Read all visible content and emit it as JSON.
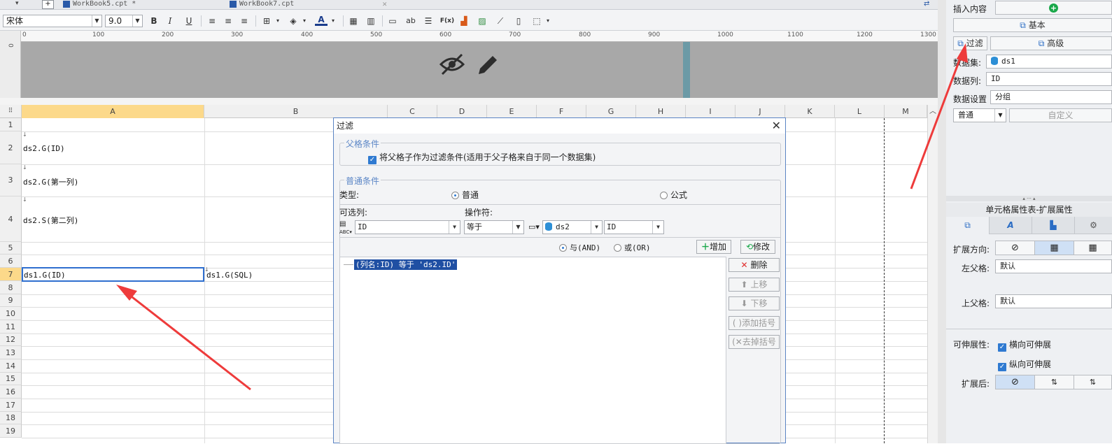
{
  "tabs": [
    {
      "label": "WorkBook5.cpt *"
    },
    {
      "label": "WorkBook7.cpt"
    }
  ],
  "toolbar": {
    "font_name": "宋体",
    "font_size": "9.0",
    "bold": "B",
    "italic": "I",
    "underline": "U",
    "abc_label": "ab",
    "fx_label": "F(x)"
  },
  "ruler": {
    "top_ticks": [
      "0",
      "100",
      "200",
      "300",
      "400",
      "500",
      "600",
      "700",
      "800",
      "900",
      "1000",
      "1100",
      "1200",
      "1300"
    ],
    "left_tick": "0"
  },
  "grid": {
    "columns": [
      "A",
      "B",
      "C",
      "D",
      "E",
      "F",
      "G",
      "H",
      "I",
      "J",
      "K",
      "L",
      "M"
    ],
    "rows": [
      "1",
      "2",
      "3",
      "4",
      "5",
      "6",
      "7",
      "8",
      "9",
      "10",
      "11",
      "12",
      "13",
      "14",
      "15",
      "16",
      "17",
      "18",
      "19"
    ],
    "cells": {
      "a2": "ds2.G(ID)",
      "a3": "ds2.G(第一列)",
      "a4": "ds2.S(第二列)",
      "a7": "ds1.G(ID)",
      "b7": "ds1.G(SQL)"
    },
    "expand_marker": "↓"
  },
  "right_panel": {
    "insert_label": "插入内容",
    "basic_button": "基本",
    "filter_button": "过滤",
    "advanced_button": "高级",
    "dataset_label": "数据集:",
    "dataset_value": "ds1",
    "datacol_label": "数据列:",
    "datacol_value": "ID",
    "datasetting_label": "数据设置",
    "datasetting_value": "分组",
    "mode_value": "普通",
    "custom_button": "自定义",
    "props_title": "单元格属性表-扩展属性",
    "expand_dir_label": "扩展方向:",
    "left_parent_label": "左父格:",
    "left_parent_value": "默认",
    "top_parent_label": "上父格:",
    "top_parent_value": "默认",
    "stretch_label": "可伸展性:",
    "horizontal_stretch": "横向可伸展",
    "vertical_stretch": "纵向可伸展",
    "after_expand_label": "扩展后:"
  },
  "dialog": {
    "title": "过滤",
    "parent_group_title": "父格条件",
    "parent_checkbox": "将父格子作为过滤条件(适用于父子格来自于同一个数据集)",
    "normal_group_title": "普通条件",
    "type_label": "类型:",
    "type_normal": "普通",
    "type_formula": "公式",
    "column_label": "可选列:",
    "operator_label": "操作符:",
    "column_value": "ID",
    "operator_value": "等于",
    "dataset_value": "ds2",
    "field_value": "ID",
    "and_label": "与(AND)",
    "or_label": "或(OR)",
    "add_button": "增加",
    "modify_button": "修改",
    "condition_item": "(列名:ID) 等于 'ds2.ID'",
    "delete_button": "删除",
    "up_button": "上移",
    "down_button": "下移",
    "add_bracket_button": "添加括号",
    "remove_bracket_button": "去掉括号"
  },
  "colors": {
    "selection": "#fcd98a",
    "accent": "#2f7ad1",
    "arrow": "#ee3b3b"
  }
}
